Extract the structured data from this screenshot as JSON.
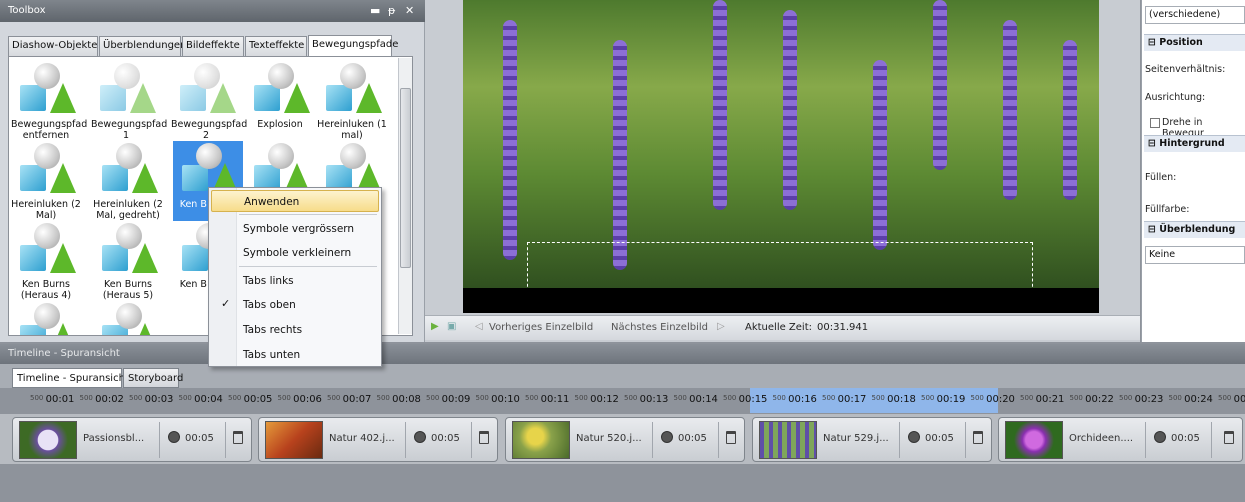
{
  "toolbox": {
    "title": "Toolbox",
    "controls": [
      "▬",
      "ᵽ",
      "✕"
    ],
    "tabs": [
      "Diashow-Objekte",
      "Überblendungen",
      "Bildeffekte",
      "Texteffekte",
      "Bewegungspfade"
    ],
    "effects": [
      {
        "label": "Bewegungspfad entfernen"
      },
      {
        "label": "Bewegungspfad 1"
      },
      {
        "label": "Bewegungspfad 2"
      },
      {
        "label": "Explosion"
      },
      {
        "label": "Hereinluken (1 mal)"
      },
      {
        "label": "Hereinluken (2 Mal)"
      },
      {
        "label": "Hereinluken (2 Mal, gedreht)"
      },
      {
        "label": "Ken B (Hera"
      },
      {
        "label": ""
      },
      {
        "label": ""
      },
      {
        "label": "Ken Burns (Heraus 4)"
      },
      {
        "label": "Ken Burns (Heraus 5)"
      },
      {
        "label": "Ken B (Here"
      }
    ]
  },
  "context_menu": {
    "items": [
      "Anwenden",
      "Symbole vergrössern",
      "Symbole verkleinern",
      "Tabs links",
      "Tabs oben",
      "Tabs rechts",
      "Tabs unten"
    ],
    "checked": "Tabs oben",
    "highlighted": "Anwenden",
    "check_mark": "✓"
  },
  "playbar": {
    "prev_label": "Vorheriges Einzelbild",
    "next_label": "Nächstes Einzelbild",
    "time_label": "Aktuelle Zeit:",
    "time_value": "00:31.941"
  },
  "properties": {
    "value_top": "(verschiedene)",
    "section_position": "Position",
    "label_ratio": "Seitenverhältnis:",
    "label_align": "Ausrichtung:",
    "checkbox_rotate": "Drehe in Bewegur",
    "section_background": "Hintergrund",
    "label_fill": "Füllen:",
    "label_fillcolor": "Füllfarbe:",
    "section_transition": "Überblendung",
    "transition_value": "Keine"
  },
  "timeline": {
    "title": "Timeline - Spuransicht",
    "tabs": [
      "Timeline - Spuransicht",
      "Storyboard"
    ],
    "ruler_small": "500",
    "ruler": [
      "00:01",
      "00:02",
      "00:03",
      "00:04",
      "00:05",
      "00:06",
      "00:07",
      "00:08",
      "00:09",
      "00:10",
      "00:11",
      "00:12",
      "00:13",
      "00:14",
      "00:15",
      "00:16",
      "00:17",
      "00:18",
      "00:19",
      "00:20",
      "00:21",
      "00:22",
      "00:23",
      "00:24",
      "00:"
    ],
    "clips": [
      {
        "name": "Passionsbl...",
        "duration": "00:05",
        "color1": "#4a6a2a",
        "color2": "#c9c3e8"
      },
      {
        "name": "Natur 402.j...",
        "duration": "00:05",
        "color1": "#b8421d",
        "color2": "#e59a3a"
      },
      {
        "name": "Natur 520.j...",
        "duration": "00:05",
        "color1": "#8aa24a",
        "color2": "#e7d44a"
      },
      {
        "name": "Natur 529.j...",
        "duration": "00:05",
        "color1": "#5f4fa8",
        "color2": "#7fa65a"
      },
      {
        "name": "Orchideen....",
        "duration": "00:05",
        "color1": "#2f6a1f",
        "color2": "#b44fd1"
      }
    ]
  },
  "colors": {
    "accent": "#3d8ee6",
    "highlight": "#f7dc8a",
    "ruler_selection": "#8fb6ea"
  }
}
